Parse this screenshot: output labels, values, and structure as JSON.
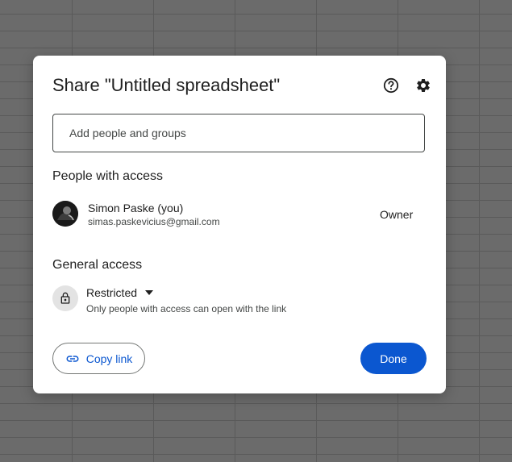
{
  "dialog": {
    "title": "Share \"Untitled spreadsheet\"",
    "icons": {
      "help": "help-circle-icon",
      "settings": "gear-icon"
    },
    "add_people": {
      "placeholder": "Add people and groups",
      "value": ""
    },
    "people_section": {
      "title": "People with access",
      "people": [
        {
          "name": "Simon Paske (you)",
          "email": "simas.paskevicius@gmail.com",
          "role": "Owner"
        }
      ]
    },
    "general_access": {
      "title": "General access",
      "icon": "lock-icon",
      "level": "Restricted",
      "description": "Only people with access can open with the link"
    },
    "buttons": {
      "copy_link": "Copy link",
      "done": "Done"
    }
  },
  "colors": {
    "accent": "#0b57d0",
    "backdrop": "#6b6b6b",
    "dialog_bg": "#ffffff"
  }
}
